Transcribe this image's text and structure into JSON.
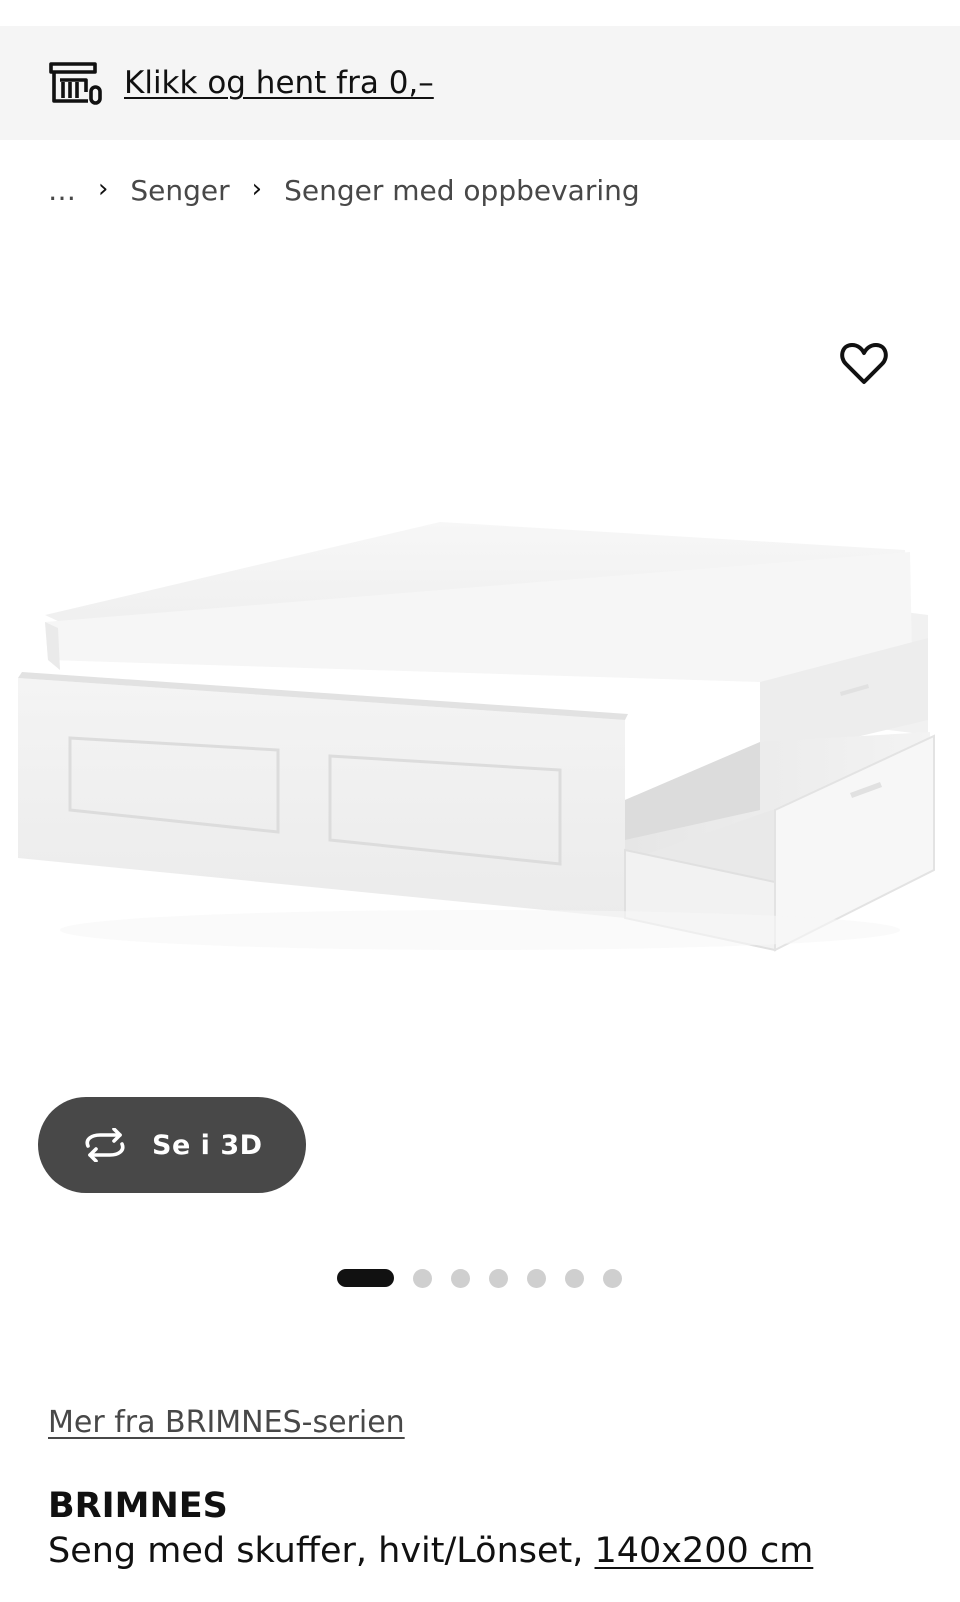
{
  "promo": {
    "icon": "store-pickup-icon",
    "link_text": "Klikk og hent fra 0,–"
  },
  "breadcrumb": {
    "items": [
      "…",
      "Senger",
      "Senger med oppbevaring"
    ],
    "separator_icon": "chevron-right-icon"
  },
  "product_media": {
    "favorite_icon": "heart-icon",
    "image_subject": "bed-frame-with-open-drawer",
    "view_3d": {
      "icon": "rotate-3d-icon",
      "label": "Se i 3D"
    },
    "carousel": {
      "total": 7,
      "active_index": 1
    }
  },
  "product": {
    "series_link": "Mer fra BRIMNES-serien",
    "name": "BRIMNES",
    "description": "Seng med skuffer, hvit/Lönset, ",
    "size_link": "140x200 cm"
  },
  "colors": {
    "promo_bg": "#f5f5f5",
    "button_3d_bg": "#484848",
    "dot_active": "#111111",
    "dot_inactive": "#cfcfcf"
  }
}
